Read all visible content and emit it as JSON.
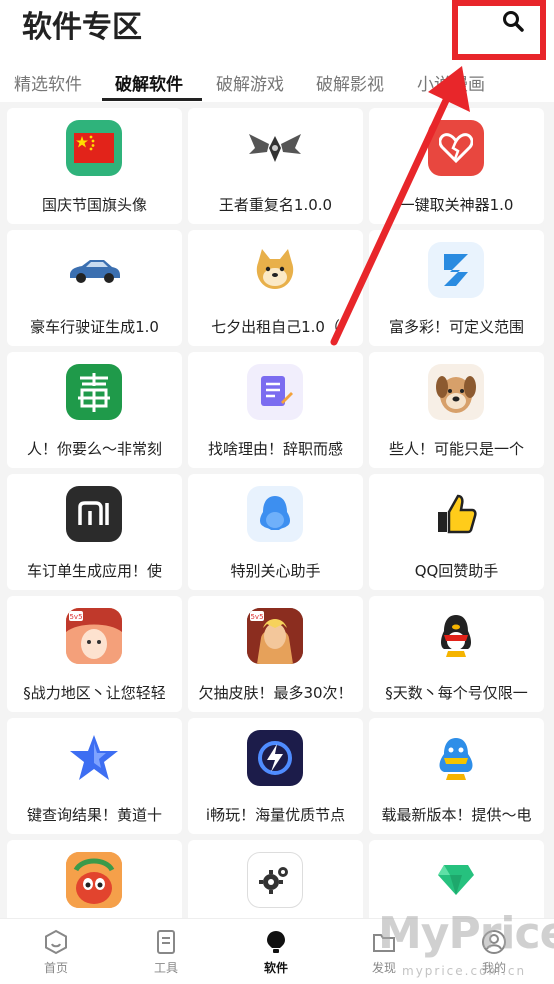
{
  "header": {
    "title": "软件专区",
    "search_icon": "search-icon"
  },
  "tabs": [
    {
      "label": "精选软件",
      "active": false
    },
    {
      "label": "破解软件",
      "active": true
    },
    {
      "label": "破解游戏",
      "active": false
    },
    {
      "label": "破解影视",
      "active": false
    },
    {
      "label": "小说漫画",
      "active": false
    }
  ],
  "apps": [
    {
      "label": "国庆节国旗头像",
      "icon": "china-flag-icon"
    },
    {
      "label": "王者重复名1.0.0",
      "icon": "wings-logo-icon"
    },
    {
      "label": "一键取关神器1.0",
      "icon": "broken-heart-icon"
    },
    {
      "label": "豪车行驶证生成1.0",
      "icon": "sports-car-icon"
    },
    {
      "label": "七夕出租自己1.0（",
      "icon": "shiba-dog-icon"
    },
    {
      "label": "富多彩！可定义范围",
      "icon": "blue-z-icon"
    },
    {
      "label": "人！你要么～非常刻",
      "icon": "poison-character-icon"
    },
    {
      "label": "找啥理由！辞职而感",
      "icon": "note-pen-icon"
    },
    {
      "label": "些人！可能只是一个",
      "icon": "dog-photo-icon"
    },
    {
      "label": "车订单生成应用！使",
      "icon": "mi-logo-icon"
    },
    {
      "label": "特别关心助手",
      "icon": "blue-penguin-icon"
    },
    {
      "label": "QQ回赞助手",
      "icon": "thumbs-up-icon"
    },
    {
      "label": "§战力地区丶让您轻轻",
      "icon": "game-heroine-icon"
    },
    {
      "label": "欠抽皮肤！最多30次！",
      "icon": "game-hero-icon"
    },
    {
      "label": "§天数丶每个号仅限一",
      "icon": "qq-penguin-red-scarf-icon"
    },
    {
      "label": "键查询结果！黄道十",
      "icon": "star-icon"
    },
    {
      "label": "i畅玩！海量优质节点",
      "icon": "lightning-vpn-icon"
    },
    {
      "label": "载最新版本！提供～电",
      "icon": "qq-penguin-blue-icon"
    },
    {
      "label": "",
      "icon": "game-character-icon"
    },
    {
      "label": "",
      "icon": "gear-icon"
    },
    {
      "label": "",
      "icon": "diamond-icon"
    }
  ],
  "nav": [
    {
      "label": "首页",
      "icon": "home-hexagon-icon",
      "active": false
    },
    {
      "label": "工具",
      "icon": "bookmark-doc-icon",
      "active": false
    },
    {
      "label": "软件",
      "icon": "bulb-icon",
      "active": true
    },
    {
      "label": "发现",
      "icon": "folder-icon",
      "active": false
    },
    {
      "label": "我的",
      "icon": "user-icon",
      "active": false
    }
  ],
  "watermark": {
    "brand": "MyPrice",
    "site": "myprice.com.cn"
  },
  "annotation_color": "#e8262a"
}
